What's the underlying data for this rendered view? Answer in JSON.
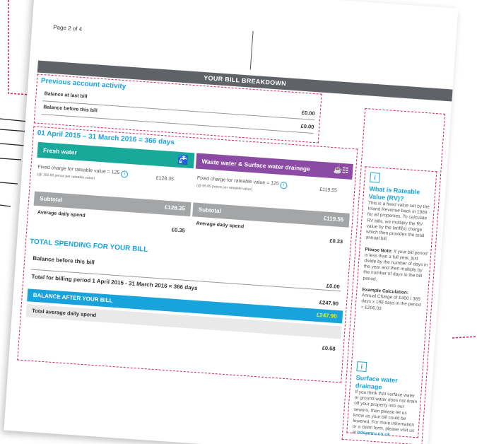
{
  "page_number": "Page 2 of 4",
  "breakdown_title": "YOUR BILL BREAKDOWN",
  "previous": {
    "title": "Previous account activity",
    "balance_last_label": "Balance at last bill",
    "balance_last_value": "£0.00",
    "balance_before_label": "Balance before this bill",
    "balance_before_value": "£0.00"
  },
  "period": {
    "title": "01 April 2015 – 31 March 2016 = 366 days",
    "fresh": {
      "title": "Fresh water",
      "fixed_label": "Fixed charge for rateable value = 125",
      "fixed_note": "(@ 102.69 pence per rateable value)",
      "fixed_value": "£128.35",
      "subtotal_label": "Subtotal",
      "subtotal_value": "£128.35",
      "avg_label": "Average daily spend",
      "avg_value": "£0.35"
    },
    "waste": {
      "title": "Waste water & Surface water drainage",
      "fixed_label": "Fixed charge for rateable value = 125",
      "fixed_note": "(@ 95.65 pence per rateable value)",
      "fixed_value": "£119.55",
      "subtotal_label": "Subtotal",
      "subtotal_value": "£119.55",
      "avg_label": "Average daily spend",
      "avg_value": "£0.33"
    }
  },
  "total": {
    "title": "TOTAL SPENDING FOR YOUR BILL",
    "before_label": "Balance before this bill",
    "before_value": "£0.00",
    "billing_label": "Total for billing period 1 April 2015 - 31 March 2016 = 366 days",
    "billing_value": "£247.90",
    "after_label": "BALANCE AFTER YOUR BILL",
    "after_value": "£247.90",
    "avg_label": "Total average daily spend",
    "avg_value": "£0.68"
  },
  "sidebar": {
    "rv_title": "What is Rateable Value (RV)?",
    "rv_text": "This is a fixed value set by the Inland Revenue back in 1989 for all properties. To calculate RV bills, we multiply the RV value by the tariff(s) charge which then provides the total annual bill.",
    "note_label": "Please Note:",
    "note_text": " If your bill period is less than a full year, just divide by the number of days in the year and then multiply by the number of days in the bill period.",
    "example_label": "Example Calculation:",
    "example_text": "Annual Charge of £400 / 365 days x 188 days in the period = £206.03",
    "sw_title": "Surface water drainage",
    "sw_text": "If you think that surface water or ground water does not drain off your property into our sewers, then please let us know as your bill could be lowered. For more information or a claim form, please visit us at ",
    "sw_link": "hdcymru.co.uk",
    "info_icon_letter": "i"
  },
  "colors": {
    "accent": "#19a3dc",
    "magenta": "#d4245f",
    "teal": "#19a99a",
    "purple": "#8b4aa3",
    "grey": "#5f6266"
  }
}
